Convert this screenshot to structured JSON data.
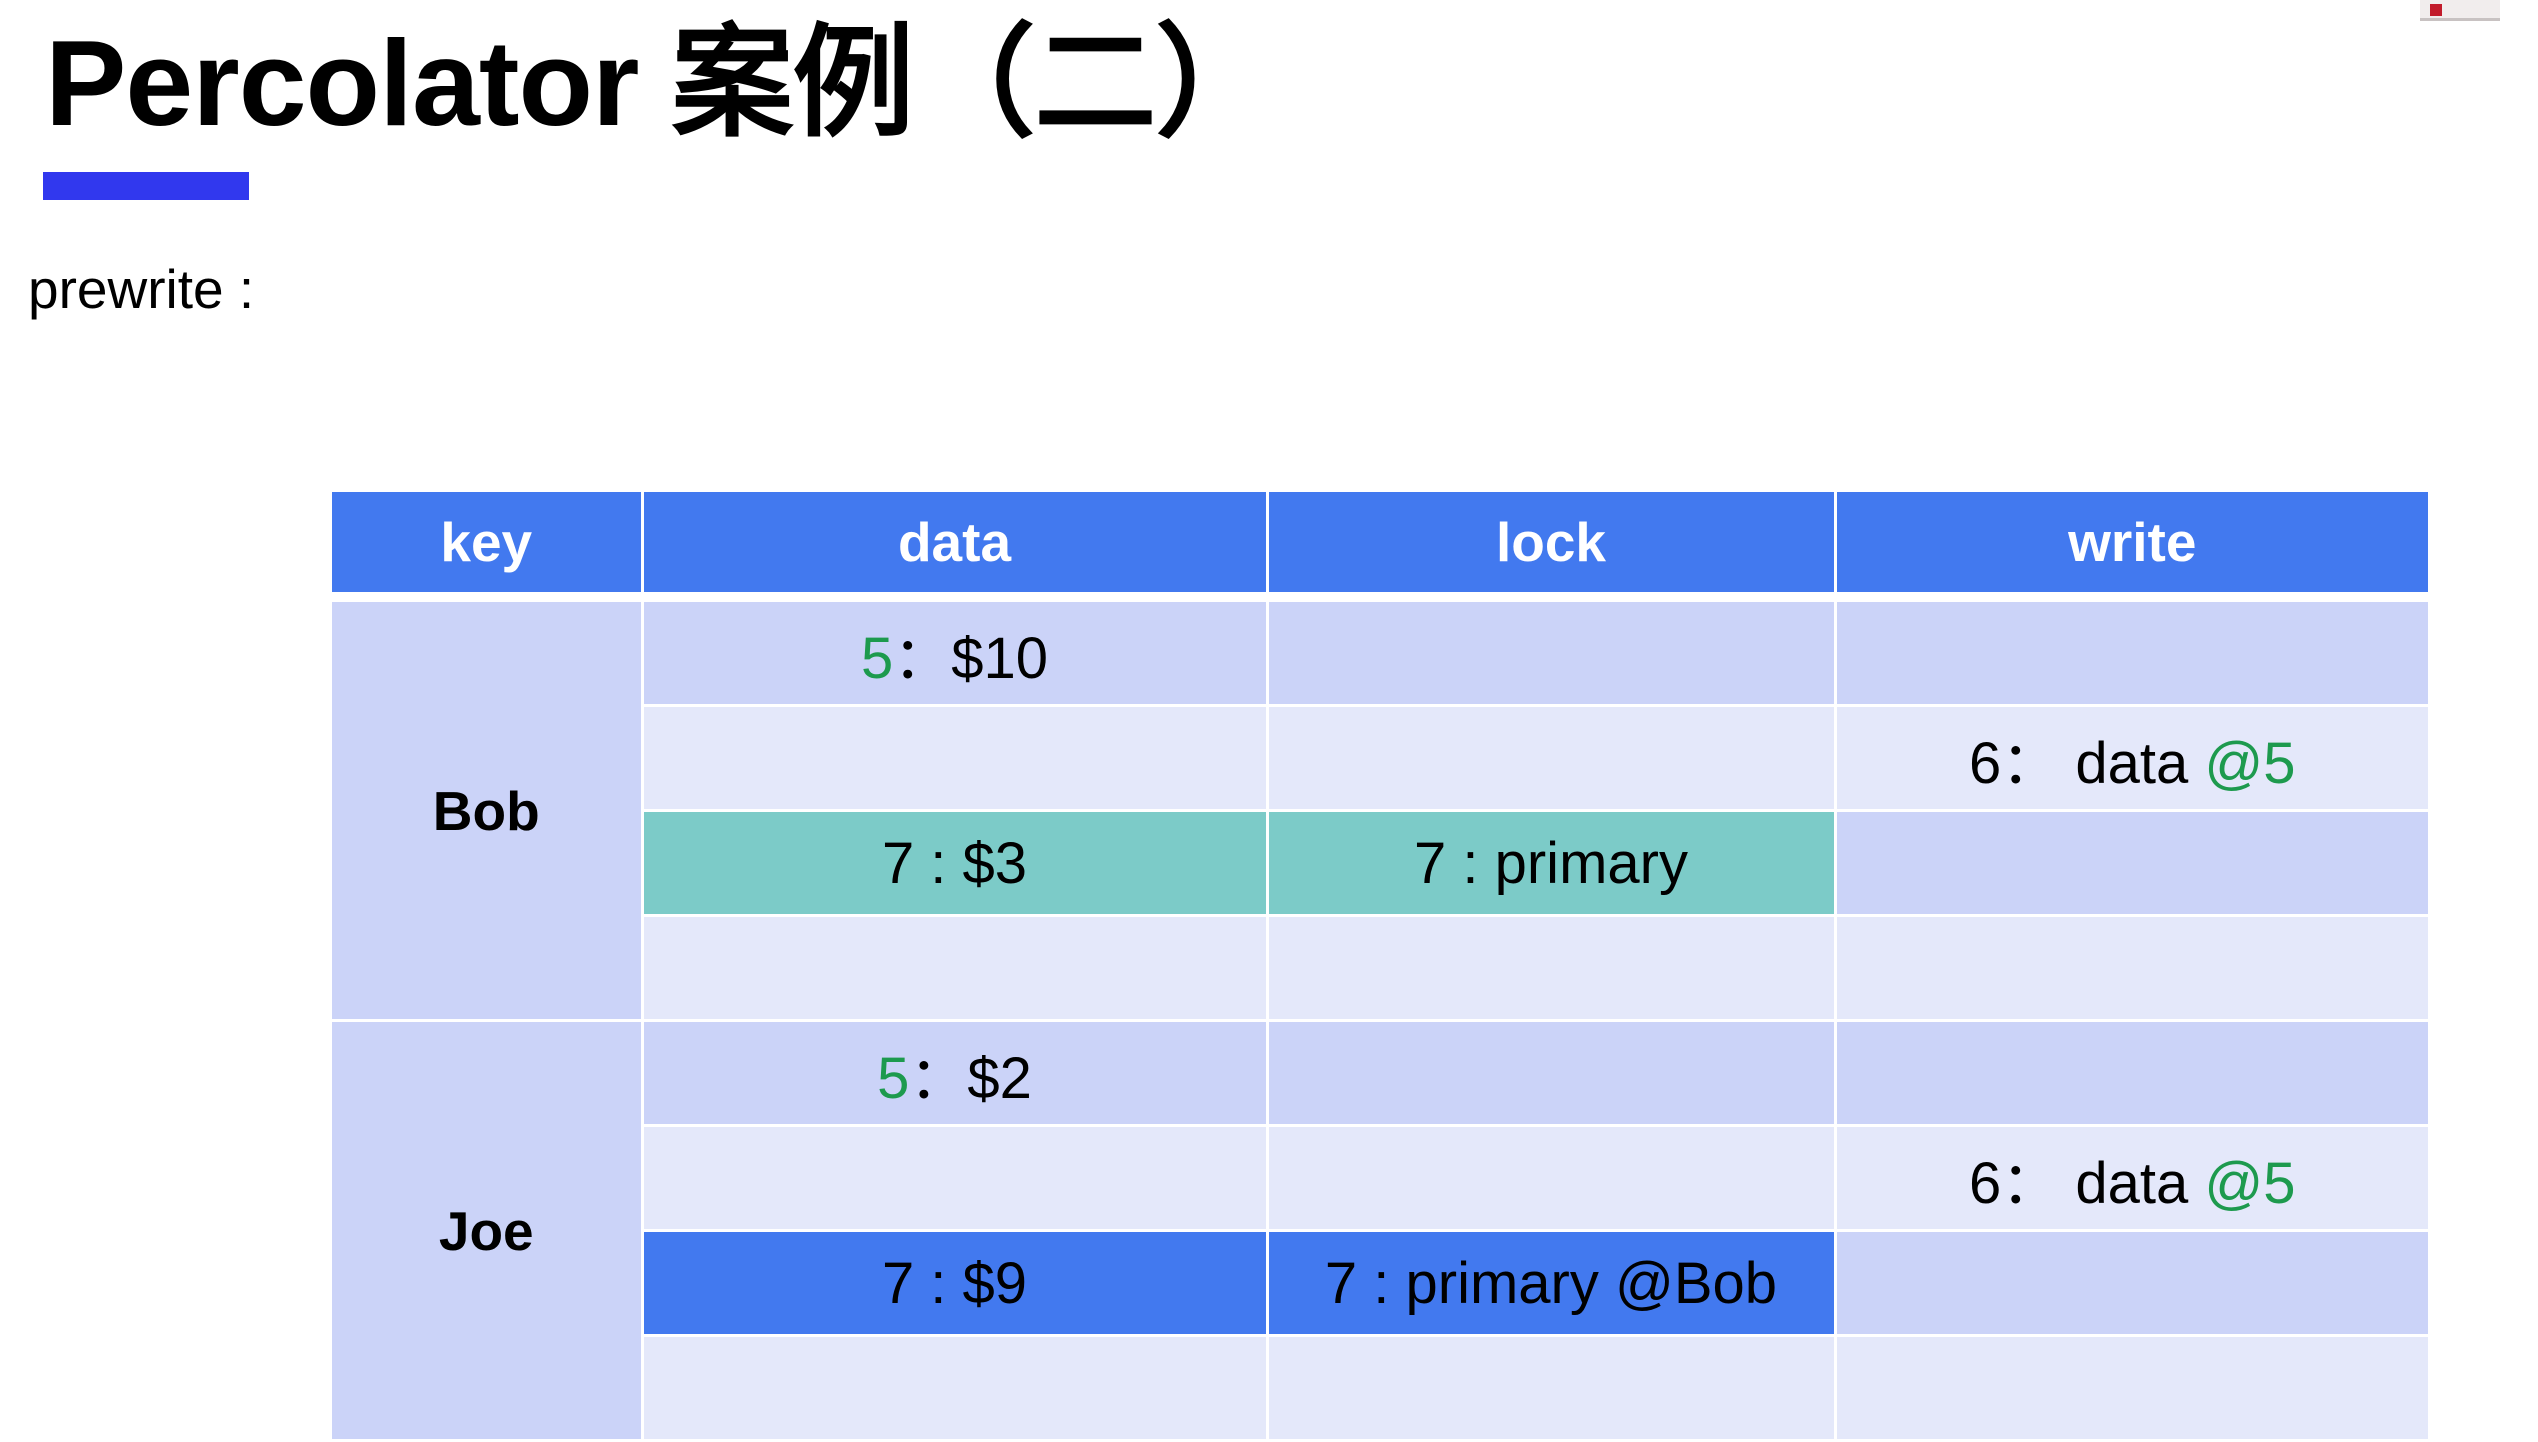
{
  "slide": {
    "title": "Percolator 案例（二）",
    "subtitle": "prewrite :"
  },
  "colors": {
    "title_bar": "#3138ee",
    "header_bg": "#4279ef",
    "row_dark": "#cbd3f8",
    "row_light": "#e4e8fa",
    "highlight_teal": "#7ccbc8",
    "highlight_blue": "#4279ef",
    "version_green": "#1d9a4e"
  },
  "table": {
    "headers": [
      "key",
      "data",
      "lock",
      "write"
    ],
    "bob": {
      "key": "Bob",
      "r1_data_ver": "5",
      "r1_data_sep": "：",
      "r1_data_val": "$10",
      "r2_write_prefix": "6：",
      "r2_write_text": "data",
      "r2_write_ver": "@5",
      "r3_data": "7 : $3",
      "r3_lock": "7 : primary"
    },
    "joe": {
      "key": "Joe",
      "r1_data_ver": "5",
      "r1_data_sep": "：",
      "r1_data_val": "$2",
      "r2_write_prefix": "6：",
      "r2_write_text": "data",
      "r2_write_ver": "@5",
      "r3_data": "7 : $9",
      "r3_lock": "7 : primary @Bob"
    }
  }
}
